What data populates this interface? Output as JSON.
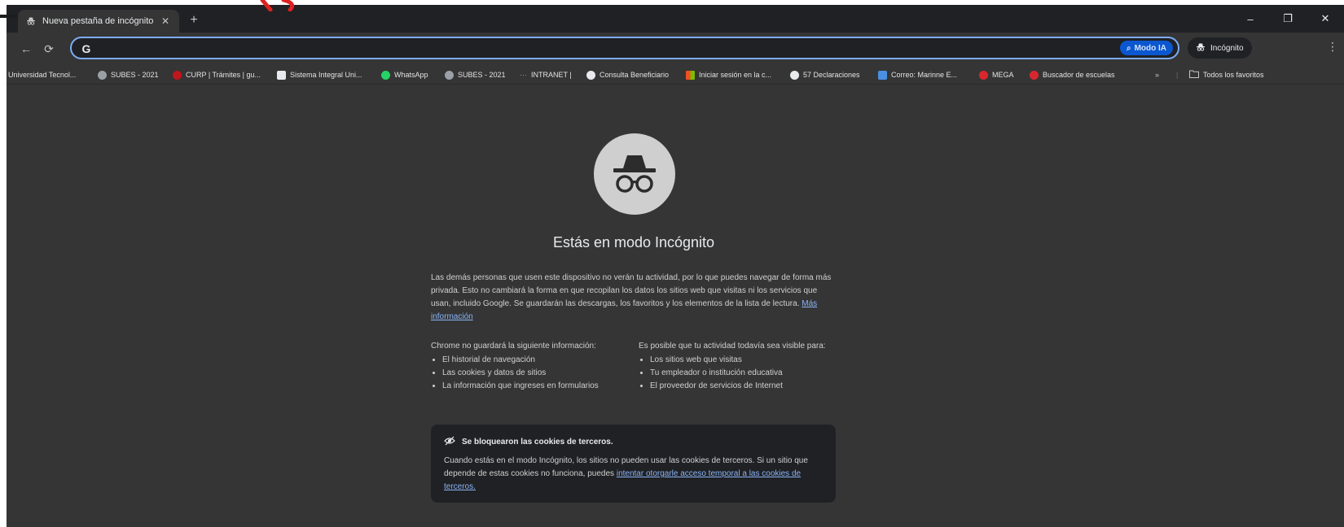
{
  "tab": {
    "title": "Nueva pestaña de incógnito"
  },
  "toolbar": {
    "ai_mode_label": "Modo IA",
    "incognito_label": "Incógnito"
  },
  "bookmarks": {
    "items": [
      "Universidad Tecnol...",
      "SUBES - 2021",
      "CURP | Trámites | gu...",
      "Sistema Integral Uni...",
      "WhatsApp",
      "SUBES - 2021",
      "INTRANET |",
      "Consulta Beneficiario",
      "Iniciar sesión en la c...",
      "57 Declaraciones",
      "Correo: Marinne E...",
      "MEGA",
      "Buscador de escuelas"
    ],
    "all_label": "Todos los favoritos"
  },
  "page": {
    "title": "Estás en modo Incógnito",
    "intro": "Las demás personas que usen este dispositivo no verán tu actividad, por lo que puedes navegar de forma más privada. Esto no cambiará la forma en que recopilan los datos los sitios web que visitas ni los servicios que usan, incluido Google. Se guardarán las descargas, los favoritos y los elementos de la lista de lectura.",
    "intro_link": "Más información",
    "left_heading": "Chrome no guardará la siguiente información:",
    "left_items": [
      "El historial de navegación",
      "Las cookies y datos de sitios",
      "La información que ingreses en formularios"
    ],
    "right_heading": "Es posible que tu actividad todavía sea visible para:",
    "right_items": [
      "Los sitios web que visitas",
      "Tu empleador o institución educativa",
      "El proveedor de servicios de Internet"
    ]
  },
  "notice": {
    "title": "Se bloquearon las cookies de terceros.",
    "text": "Cuando estás en el modo Incógnito, los sitios no pueden usar las cookies de terceros. Si un sitio que depende de estas cookies no funciona, puedes",
    "link": "intentar otorgarle acceso temporal a las cookies de terceros."
  }
}
